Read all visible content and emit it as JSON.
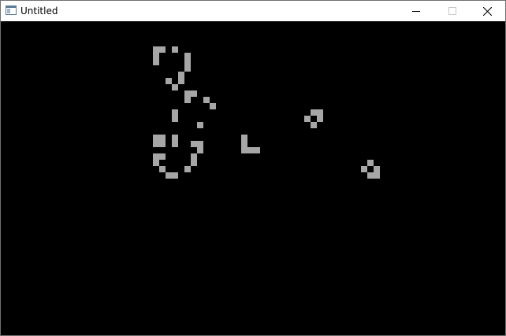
{
  "window": {
    "title": "Untitled",
    "controls": {
      "minimize_icon": "minimize-icon",
      "maximize_icon": "maximize-icon",
      "close_icon": "close-icon"
    }
  },
  "canvas": {
    "background": "#000000",
    "cell_color": "#a6a6a6"
  }
}
